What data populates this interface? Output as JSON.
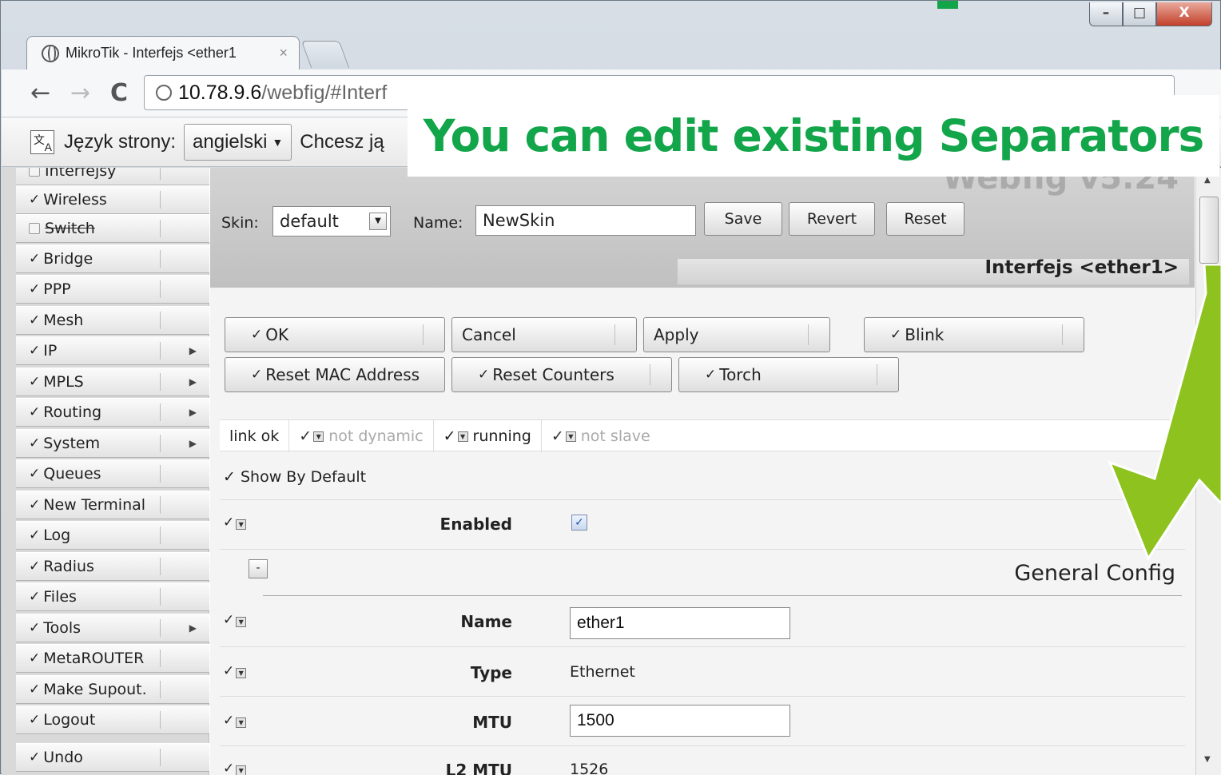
{
  "banner": {
    "text": "You can edit existing Separators"
  },
  "window": {
    "minimize": "–",
    "maximize": "□",
    "close": "X"
  },
  "tab": {
    "title": "MikroTik - Interfejs <ether1",
    "close": "×"
  },
  "toolbar": {
    "back": "←",
    "forward": "→",
    "reload": "C",
    "url_host": "10.78.9.6",
    "url_path": "/webfig/#Interf"
  },
  "translate_bar": {
    "page_language_label": "Język strony:",
    "language": "angielski",
    "prompt": "Chcesz ją"
  },
  "sidebar": {
    "items": [
      {
        "label": "Interfejsy",
        "checked": true,
        "submenu": false
      },
      {
        "label": "Wireless",
        "checked": true,
        "submenu": false
      },
      {
        "label": "Switch",
        "checked": false,
        "submenu": false
      },
      {
        "label": "Bridge",
        "checked": true,
        "submenu": false
      },
      {
        "label": "PPP",
        "checked": true,
        "submenu": false
      },
      {
        "label": "Mesh",
        "checked": true,
        "submenu": false
      },
      {
        "label": "IP",
        "checked": true,
        "submenu": true
      },
      {
        "label": "MPLS",
        "checked": true,
        "submenu": true
      },
      {
        "label": "Routing",
        "checked": true,
        "submenu": true
      },
      {
        "label": "System",
        "checked": true,
        "submenu": true
      },
      {
        "label": "Queues",
        "checked": true,
        "submenu": false
      },
      {
        "label": "New Terminal",
        "checked": true,
        "submenu": false
      },
      {
        "label": "Log",
        "checked": true,
        "submenu": false
      },
      {
        "label": "Radius",
        "checked": true,
        "submenu": false
      },
      {
        "label": "Files",
        "checked": true,
        "submenu": false
      },
      {
        "label": "Tools",
        "checked": true,
        "submenu": true
      },
      {
        "label": "MetaROUTER",
        "checked": true,
        "submenu": false
      },
      {
        "label": "Make Supout.",
        "checked": true,
        "submenu": false
      },
      {
        "label": "Logout",
        "checked": true,
        "submenu": false
      },
      {
        "label": "Undo",
        "checked": true,
        "submenu": false
      }
    ]
  },
  "skin": {
    "skin_label": "Skin:",
    "skin_value": "default",
    "name_label": "Name:",
    "name_value": "NewSkin",
    "save": "Save",
    "revert": "Revert",
    "reset": "Reset",
    "version": "Webfig v5.24"
  },
  "page_title": "Interfejs <ether1>",
  "actions": {
    "ok": "OK",
    "cancel": "Cancel",
    "apply": "Apply",
    "blink": "Blink",
    "reset_mac": "Reset MAC Address",
    "reset_counters": "Reset Counters",
    "torch": "Torch"
  },
  "status": {
    "link": "link ok",
    "dynamic": "not dynamic",
    "running": "running",
    "slave": "not slave"
  },
  "show_by_default": "Show By Default",
  "fields": {
    "enabled_label": "Enabled",
    "enabled_value": "✓",
    "collapse": "-",
    "separator_title": "General Config",
    "name_label": "Name",
    "name_value": "ether1",
    "type_label": "Type",
    "type_value": "Ethernet",
    "mtu_label": "MTU",
    "mtu_value": "1500",
    "l2mtu_label": "L2 MTU",
    "l2mtu_value": "1526"
  },
  "colors": {
    "banner_text": "#12a54a",
    "arrow_fill": "#8dc21f"
  }
}
